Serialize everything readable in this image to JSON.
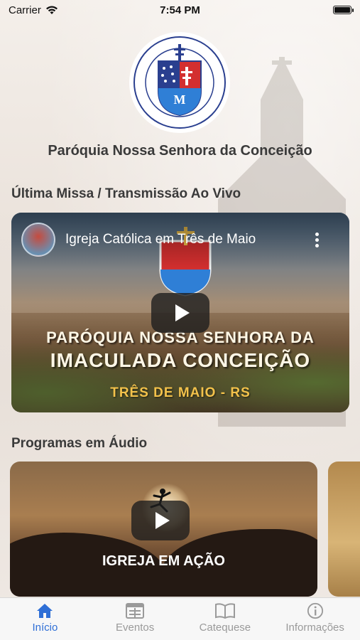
{
  "status_bar": {
    "carrier": "Carrier",
    "time": "7:54 PM",
    "wifi_icon": "wifi-icon",
    "battery_icon": "battery-icon"
  },
  "header": {
    "logo_icon": "parish-crest-logo",
    "title": "Paróquia Nossa Senhora da Conceição"
  },
  "live_section": {
    "title": "Última Missa / Transmissão Ao Vivo",
    "video": {
      "title": "Igreja Católica em Três de Maio",
      "banner_line1": "PARÓQUIA NOSSA SENHORA DA",
      "banner_line2": "IMACULADA CONCEIÇÃO",
      "banner_line3": "TRÊS DE MAIO - RS",
      "play_icon": "play-icon",
      "more_icon": "more-vertical-icon"
    }
  },
  "audio_section": {
    "title": "Programas em Áudio",
    "items": [
      {
        "title": "IGREJA EM AÇÃO",
        "play_icon": "play-icon"
      }
    ]
  },
  "tab_bar": {
    "active_color": "#2f6fd6",
    "inactive_color": "#9a9a9a",
    "tabs": [
      {
        "label": "Início",
        "icon": "home-icon",
        "active": true
      },
      {
        "label": "Eventos",
        "icon": "calendar-icon",
        "active": false
      },
      {
        "label": "Catequese",
        "icon": "book-icon",
        "active": false
      },
      {
        "label": "Informações",
        "icon": "info-icon",
        "active": false
      }
    ]
  }
}
